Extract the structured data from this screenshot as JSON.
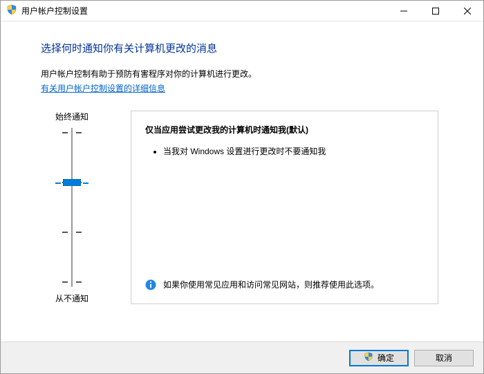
{
  "window": {
    "title": "用户帐户控制设置"
  },
  "header": {
    "title": "选择何时通知你有关计算机更改的消息",
    "description": "用户帐户控制有助于预防有害程序对你的计算机进行更改。",
    "link": "有关用户帐户控制设置的详细信息"
  },
  "slider": {
    "top_label": "始终通知",
    "bottom_label": "从不通知",
    "level": 2
  },
  "detail": {
    "title": "仅当应用尝试更改我的计算机时通知我(默认)",
    "bullets": [
      "当我对 Windows 设置进行更改时不要通知我"
    ],
    "recommendation": "如果你使用常见应用和访问常见网站，则推荐使用此选项。"
  },
  "buttons": {
    "ok": "确定",
    "cancel": "取消"
  }
}
